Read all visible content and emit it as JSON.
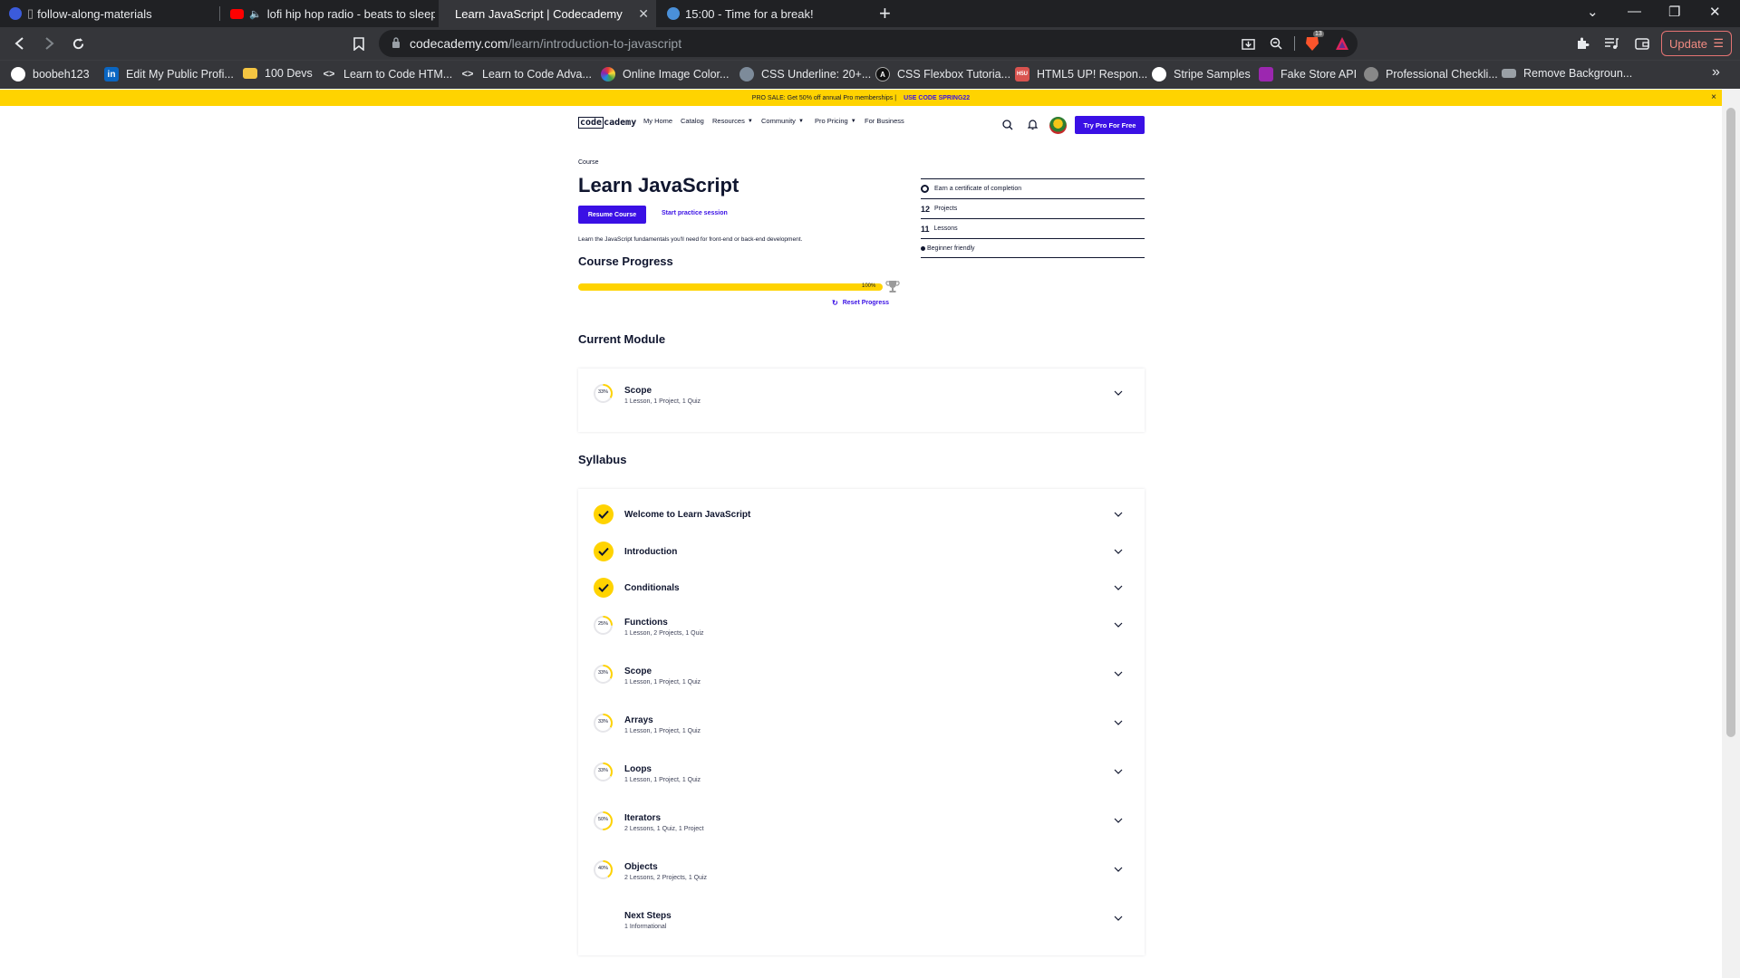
{
  "browser": {
    "tabs": [
      {
        "title": "follow-along-materials",
        "icon": "github-favicon"
      },
      {
        "title": "lofi hip hop radio - beats to sleep/",
        "icon": "youtube-favicon"
      },
      {
        "title": "Learn JavaScript | Codecademy",
        "icon": "codecademy-favicon"
      },
      {
        "title": "15:00 - Time for a break!",
        "icon": "timer-favicon"
      }
    ],
    "url_host": "codecademy.com",
    "url_path": "/learn/introduction-to-javascript",
    "update_label": "Update",
    "bookmarks": [
      "boobeh123",
      "Edit My Public Profi...",
      "100 Devs",
      "Learn to Code HTM...",
      "Learn to Code Adva...",
      "Online Image Color...",
      "CSS Underline: 20+...",
      "CSS Flexbox Tutoria...",
      "HTML5 UP! Respon...",
      "Stripe Samples",
      "Fake Store API",
      "Professional Checkli...",
      "Remove Backgroun..."
    ],
    "bookmarks_overflow": "»",
    "brave_badge": "13"
  },
  "promo": {
    "text": "PRO SALE: Get 50% off annual Pro memberships |",
    "code": "USE CODE SPRING22",
    "close": "×"
  },
  "nav": {
    "logo_left": "code",
    "logo_right": "cademy",
    "items": [
      "My Home",
      "Catalog",
      "Resources",
      "Community",
      "Pro Pricing",
      "For Business"
    ],
    "cta": "Try Pro For Free"
  },
  "course": {
    "crumb": "Course",
    "title": "Learn JavaScript",
    "resume": "Resume Course",
    "practice": "Start practice session",
    "description": "Learn the JavaScript fundamentals you'll need for front-end or back-end development.",
    "progress_heading": "Course Progress",
    "progress_value": 1.0,
    "progress_label": "100%",
    "reset": "Reset Progress",
    "facts": {
      "certificate": "Earn a certificate of completion",
      "projects_num": "12",
      "projects_label": "Projects",
      "lessons_num": "11",
      "lessons_label": "Lessons",
      "level": "Beginner friendly"
    }
  },
  "current_module": {
    "heading": "Current Module",
    "name": "Scope",
    "detail": "1 Lesson, 1 Project, 1 Quiz",
    "percent_label": "33%",
    "percent": 0.33
  },
  "syllabus": {
    "heading": "Syllabus",
    "modules": [
      {
        "name": "Welcome to Learn JavaScript",
        "detail": "",
        "complete": true,
        "percent_label": "",
        "percent": 1.0
      },
      {
        "name": "Introduction",
        "detail": "",
        "complete": true,
        "percent_label": "",
        "percent": 1.0
      },
      {
        "name": "Conditionals",
        "detail": "",
        "complete": true,
        "percent_label": "",
        "percent": 1.0
      },
      {
        "name": "Functions",
        "detail": "1 Lesson, 2 Projects, 1 Quiz",
        "complete": false,
        "percent_label": "25%",
        "percent": 0.25
      },
      {
        "name": "Scope",
        "detail": "1 Lesson, 1 Project, 1 Quiz",
        "complete": false,
        "percent_label": "33%",
        "percent": 0.33
      },
      {
        "name": "Arrays",
        "detail": "1 Lesson, 1 Project, 1 Quiz",
        "complete": false,
        "percent_label": "33%",
        "percent": 0.33
      },
      {
        "name": "Loops",
        "detail": "1 Lesson, 1 Project, 1 Quiz",
        "complete": false,
        "percent_label": "33%",
        "percent": 0.33
      },
      {
        "name": "Iterators",
        "detail": "2 Lessons, 1 Quiz, 1 Project",
        "complete": false,
        "percent_label": "50%",
        "percent": 0.5
      },
      {
        "name": "Objects",
        "detail": "2 Lessons, 2 Projects, 1 Quiz",
        "complete": false,
        "percent_label": "40%",
        "percent": 0.4
      },
      {
        "name": "Next Steps",
        "detail": "1 Informational",
        "complete": false,
        "percent_label": "",
        "percent": 0
      }
    ]
  },
  "colors": {
    "brand_purple": "#3a10e5",
    "brand_yellow": "#ffd300",
    "navy": "#10162f"
  }
}
